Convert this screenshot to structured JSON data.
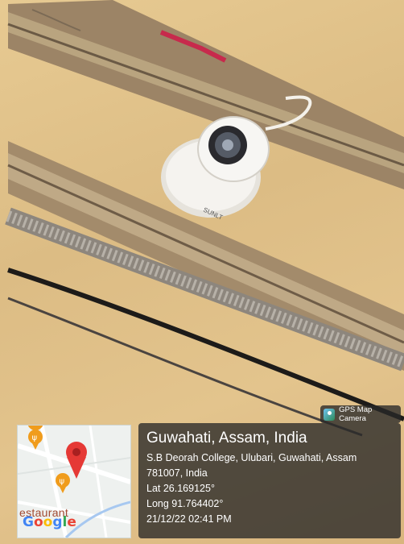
{
  "badge": {
    "label": "GPS Map Camera",
    "icon": "gps-map-camera-icon"
  },
  "location": {
    "title": "Guwahati, Assam, India",
    "address_line1": "S.B Deorah College, Ulubari, Guwahati, Assam",
    "address_line2": "781007, India",
    "lat": "Lat 26.169125°",
    "long": "Long 91.764402°",
    "datetime": "21/12/22 02:41 PM"
  },
  "map": {
    "poi_label": "estaurant",
    "logo_letters": [
      "G",
      "o",
      "o",
      "g",
      "l",
      "e"
    ]
  },
  "camera": {
    "brand_text": "SUNLT"
  }
}
